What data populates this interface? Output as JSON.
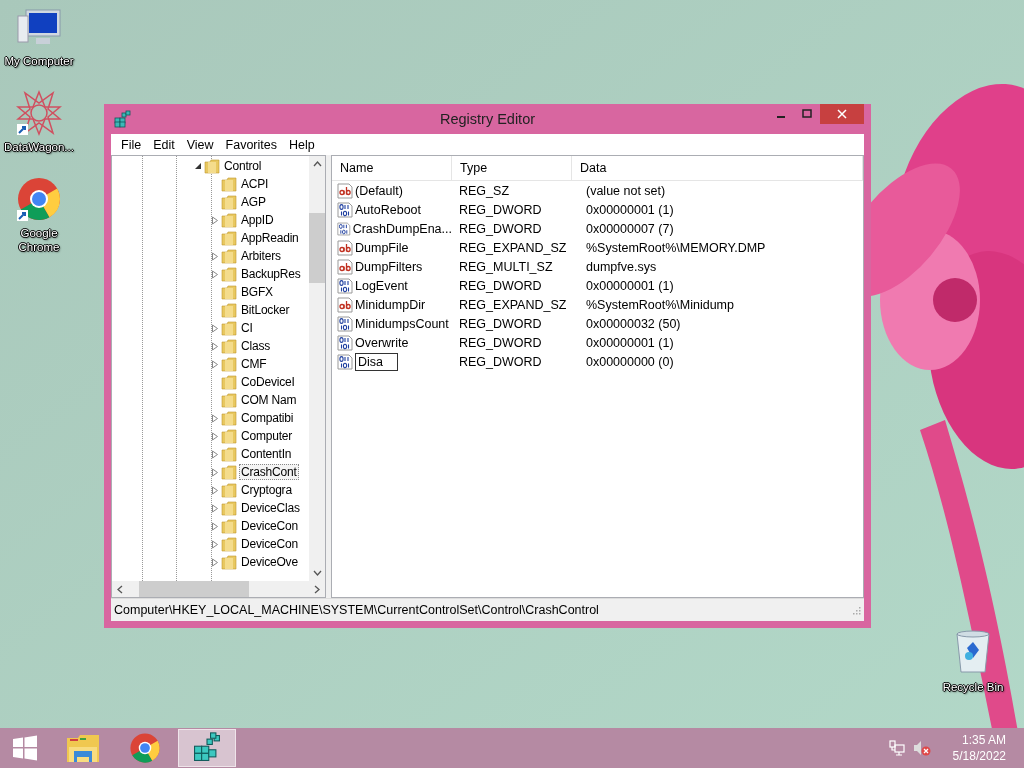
{
  "desktop_icons": [
    {
      "label": "My Computer",
      "kind": "computer"
    },
    {
      "label": "DataWagon...",
      "kind": "star"
    },
    {
      "label": "Google Chrome",
      "kind": "chrome"
    }
  ],
  "recycle_bin": {
    "label": "Recycle Bin"
  },
  "window": {
    "title": "Registry Editor"
  },
  "menu": [
    "File",
    "Edit",
    "View",
    "Favorites",
    "Help"
  ],
  "tree": {
    "label": "Control",
    "expanded": true,
    "children": [
      {
        "label": "ACPI",
        "has_children": false,
        "selected": false
      },
      {
        "label": "AGP",
        "has_children": false,
        "selected": false
      },
      {
        "label": "AppID",
        "has_children": true,
        "selected": false
      },
      {
        "label": "AppReadin",
        "has_children": false,
        "selected": false
      },
      {
        "label": "Arbiters",
        "has_children": true,
        "selected": false
      },
      {
        "label": "BackupRes",
        "has_children": true,
        "selected": false
      },
      {
        "label": "BGFX",
        "has_children": false,
        "selected": false
      },
      {
        "label": "BitLocker",
        "has_children": false,
        "selected": false
      },
      {
        "label": "CI",
        "has_children": true,
        "selected": false
      },
      {
        "label": "Class",
        "has_children": true,
        "selected": false
      },
      {
        "label": "CMF",
        "has_children": true,
        "selected": false
      },
      {
        "label": "CoDeviceI",
        "has_children": false,
        "selected": false
      },
      {
        "label": "COM Nam",
        "has_children": false,
        "selected": false
      },
      {
        "label": "Compatibi",
        "has_children": true,
        "selected": false
      },
      {
        "label": "Computer",
        "has_children": true,
        "selected": false
      },
      {
        "label": "ContentIn",
        "has_children": true,
        "selected": false
      },
      {
        "label": "CrashCont",
        "has_children": true,
        "selected": true
      },
      {
        "label": "Cryptogra",
        "has_children": true,
        "selected": false
      },
      {
        "label": "DeviceClas",
        "has_children": true,
        "selected": false
      },
      {
        "label": "DeviceCon",
        "has_children": true,
        "selected": false
      },
      {
        "label": "DeviceCon",
        "has_children": true,
        "selected": false
      },
      {
        "label": "DeviceOve",
        "has_children": true,
        "selected": false
      }
    ]
  },
  "table": {
    "columns": [
      "Name",
      "Type",
      "Data"
    ],
    "rows": [
      {
        "kind": "string",
        "name": "(Default)",
        "type": "REG_SZ",
        "data": "(value not set)",
        "editing": false
      },
      {
        "kind": "number",
        "name": "AutoReboot",
        "type": "REG_DWORD",
        "data": "0x00000001 (1)",
        "editing": false
      },
      {
        "kind": "number",
        "name": "CrashDumpEna...",
        "type": "REG_DWORD",
        "data": "0x00000007 (7)",
        "editing": false
      },
      {
        "kind": "string",
        "name": "DumpFile",
        "type": "REG_EXPAND_SZ",
        "data": "%SystemRoot%\\MEMORY.DMP",
        "editing": false
      },
      {
        "kind": "string",
        "name": "DumpFilters",
        "type": "REG_MULTI_SZ",
        "data": "dumpfve.sys",
        "editing": false
      },
      {
        "kind": "number",
        "name": "LogEvent",
        "type": "REG_DWORD",
        "data": "0x00000001 (1)",
        "editing": false
      },
      {
        "kind": "string",
        "name": "MinidumpDir",
        "type": "REG_EXPAND_SZ",
        "data": "%SystemRoot%\\Minidump",
        "editing": false
      },
      {
        "kind": "number",
        "name": "MinidumpsCount",
        "type": "REG_DWORD",
        "data": "0x00000032 (50)",
        "editing": false
      },
      {
        "kind": "number",
        "name": "Overwrite",
        "type": "REG_DWORD",
        "data": "0x00000001 (1)",
        "editing": false
      },
      {
        "kind": "number",
        "name": "Disa",
        "type": "REG_DWORD",
        "data": "0x00000000 (0)",
        "editing": true
      }
    ]
  },
  "status_bar": "Computer\\HKEY_LOCAL_MACHINE\\SYSTEM\\CurrentControlSet\\Control\\CrashControl",
  "taskbar": {
    "apps": [
      {
        "kind": "explorer",
        "selected": false
      },
      {
        "kind": "chrome",
        "selected": false
      },
      {
        "kind": "regedit",
        "selected": true
      }
    ],
    "time": "1:35 AM",
    "date": "5/18/2022"
  }
}
